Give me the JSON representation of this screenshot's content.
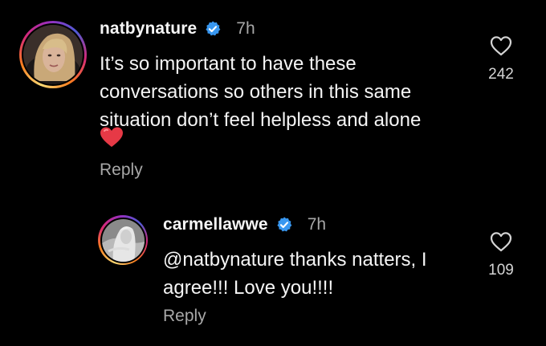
{
  "comments": [
    {
      "username": "natbynature",
      "time": "7h",
      "text": "It’s so important to have these conversations so others in this same situation don’t feel helpless and alone",
      "emoji": "❤️",
      "reply_label": "Reply",
      "like_count": "242",
      "verified_icon": "verified-badge-icon",
      "like_icon": "heart-outline-icon"
    },
    {
      "username": "carmellawwe",
      "time": "7h",
      "text": "@natbynature thanks natters, I agree!!! Love you!!!!",
      "reply_label": "Reply",
      "like_count": "109",
      "verified_icon": "verified-badge-icon",
      "like_icon": "heart-outline-icon"
    }
  ],
  "colors": {
    "background": "#000000",
    "text": "#f5f5f5",
    "secondary": "#a8a8a8",
    "verified": "#3897f0",
    "emoji_heart": "#e63946"
  }
}
